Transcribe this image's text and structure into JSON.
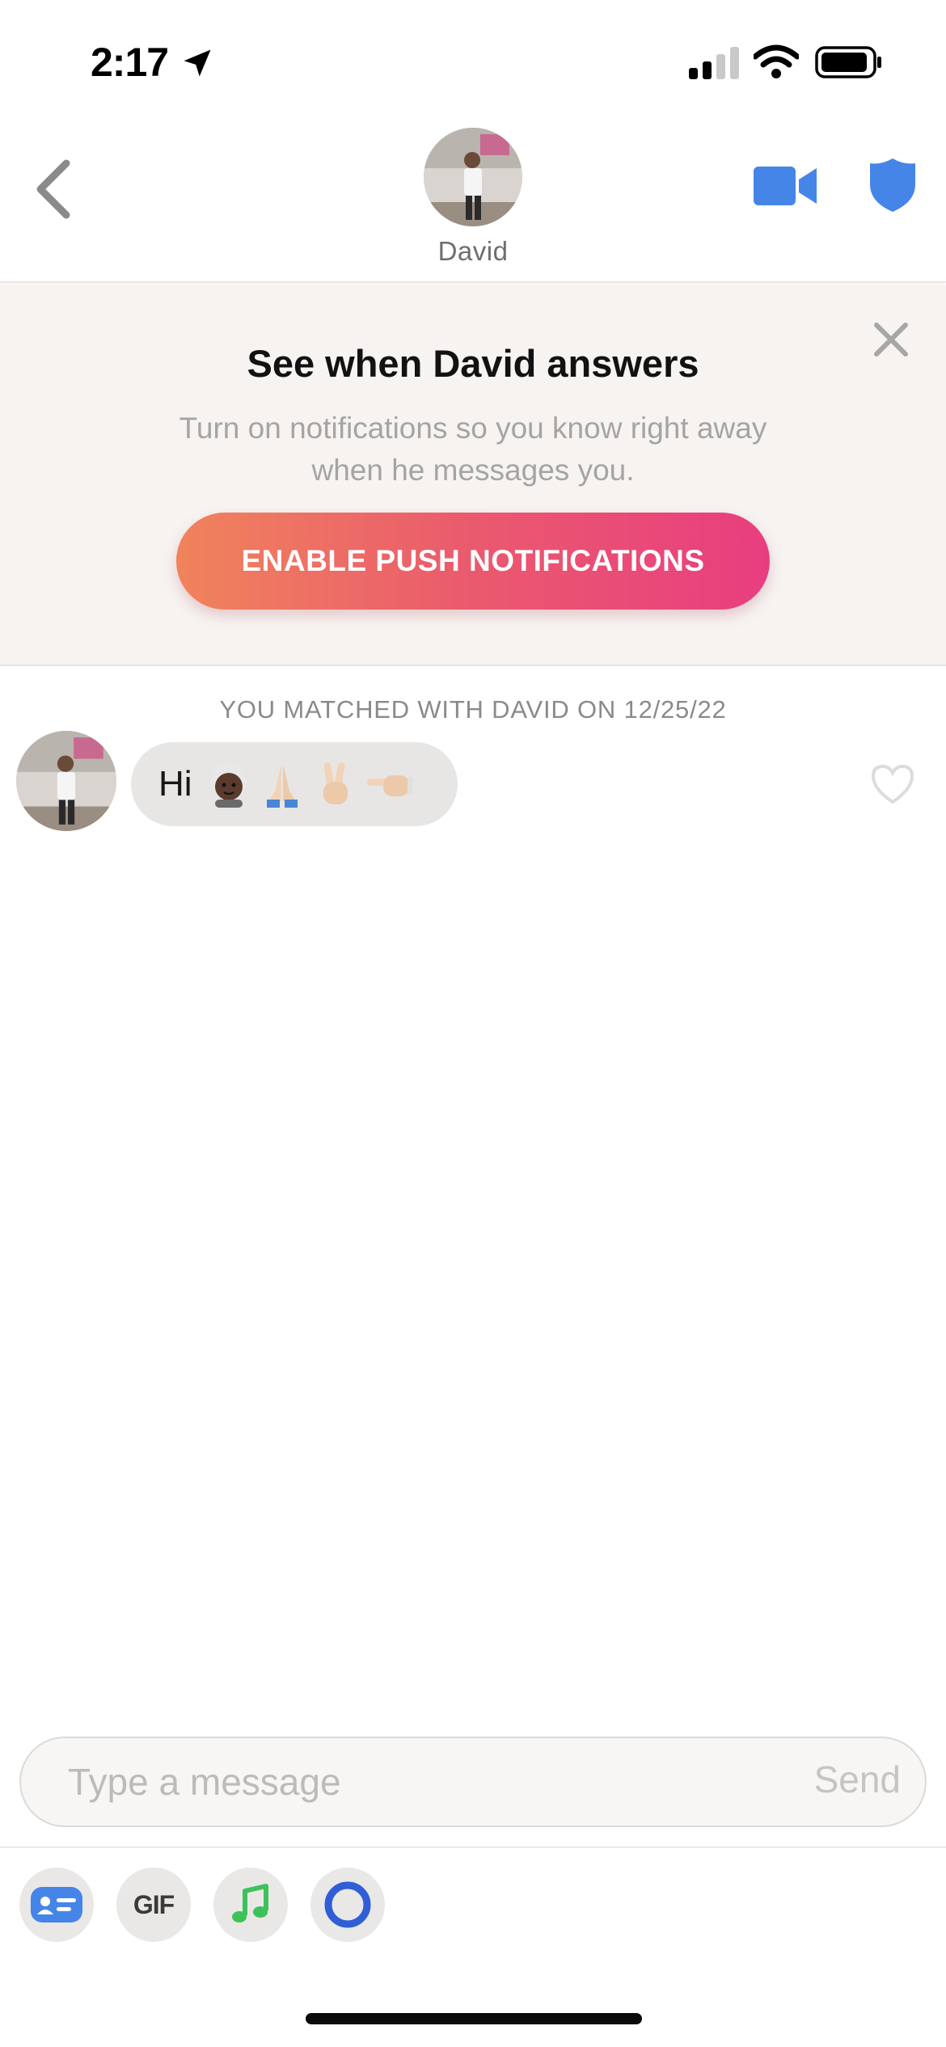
{
  "status_bar": {
    "time": "2:17",
    "icons": [
      "location-arrow-icon",
      "cellular-signal-icon",
      "wifi-icon",
      "battery-icon"
    ]
  },
  "header": {
    "contact_name": "David",
    "icons": [
      "back-chevron-icon",
      "video-camera-icon",
      "shield-icon"
    ]
  },
  "banner": {
    "title": "See when David answers",
    "text": "Turn on notifications so you know right away when he messages you.",
    "button_label": "ENABLE PUSH NOTIFICATIONS",
    "close_icon": "close-icon"
  },
  "chat": {
    "matched_text": "YOU MATCHED WITH DAVID ON 12/25/22",
    "messages": [
      {
        "sender": "David",
        "text": "Hi",
        "emojis": [
          "older-woman-emoji",
          "folded-hands-emoji",
          "victory-hand-emoji",
          "pointing-left-emoji"
        ]
      }
    ]
  },
  "composer": {
    "placeholder": "Type a message",
    "send_label": "Send"
  },
  "toolbar": {
    "gif_label": "GIF",
    "tools": [
      "card-icon",
      "gif-icon",
      "music-note-icon",
      "ring-icon"
    ]
  },
  "colors": {
    "accent_blue": "#4685e8",
    "gradient_start": "#f0835c",
    "gradient_end": "#e83e80",
    "banner_bg": "#f6f3f1",
    "bubble_bg": "#e8e6e5"
  }
}
